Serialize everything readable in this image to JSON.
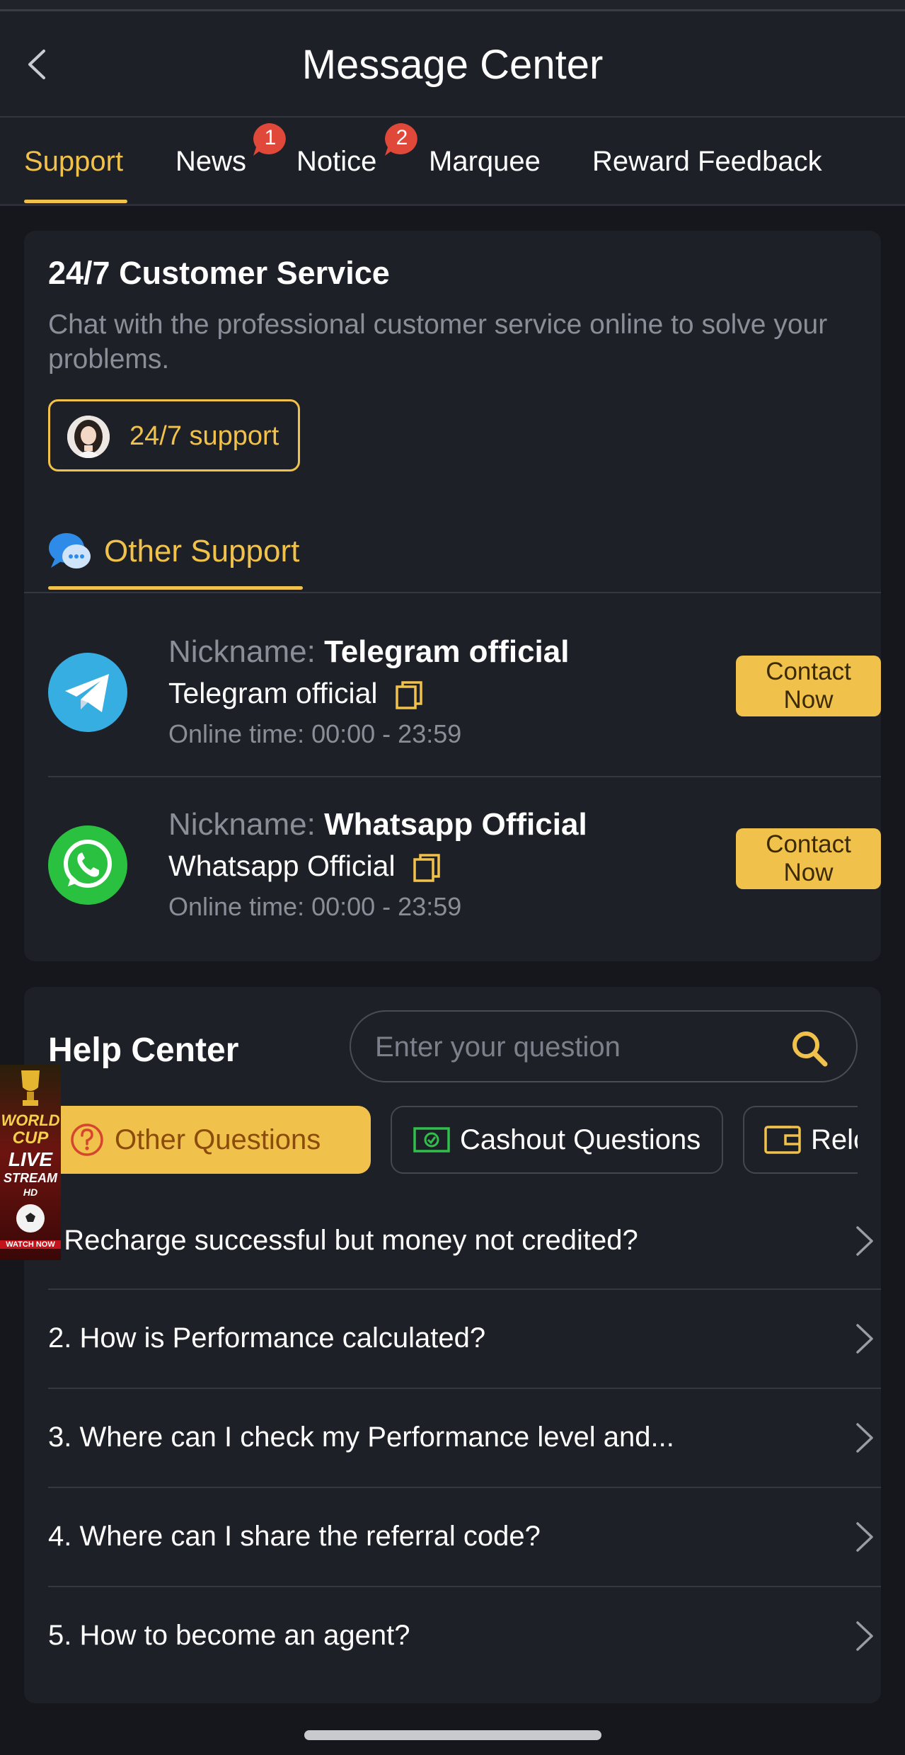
{
  "header": {
    "title": "Message Center",
    "back_icon": "chevron-left-icon"
  },
  "tabs": [
    {
      "label": "Support",
      "active": true
    },
    {
      "label": "News",
      "badge": "1"
    },
    {
      "label": "Notice",
      "badge": "2"
    },
    {
      "label": "Marquee"
    },
    {
      "label": "Reward Feedback"
    }
  ],
  "customer_service": {
    "title": "24/7 Customer Service",
    "description": "Chat with the professional customer service online to solve your problems.",
    "button_label": "24/7 support"
  },
  "other_support": {
    "title": "Other Support",
    "contacts": [
      {
        "nickname_key": "Nickname:",
        "nickname": "Telegram official",
        "account": "Telegram official",
        "online_key": "Online time:",
        "online_time": "00:00 - 23:59",
        "button": "Contact Now",
        "icon": "telegram-icon"
      },
      {
        "nickname_key": "Nickname:",
        "nickname": "Whatsapp Official",
        "account": "Whatsapp Official",
        "online_key": "Online time:",
        "online_time": "00:00 - 23:59",
        "button": "Contact Now",
        "icon": "whatsapp-icon"
      }
    ]
  },
  "help_center": {
    "title": "Help Center",
    "search_placeholder": "Enter your question",
    "categories": [
      {
        "label": "Other Questions",
        "active": true
      },
      {
        "label": "Cashout Questions"
      },
      {
        "label": "Reloa"
      }
    ],
    "questions": [
      ". Recharge successful but money not credited?",
      "2. How is Performance calculated?",
      "3. Where can I check my Performance level and...",
      "4. Where can I share the referral code?",
      "5. How to become an agent?"
    ]
  },
  "promo": {
    "lines": [
      "WORLD",
      "CUP",
      "LIVE",
      "STREAM",
      "HD",
      "WATCH NOW"
    ]
  },
  "colors": {
    "accent": "#f0c14b",
    "background": "#15171d",
    "card": "#1e2027",
    "badge": "#e0483a",
    "telegram": "#37aee2",
    "whatsapp": "#29c13f"
  }
}
